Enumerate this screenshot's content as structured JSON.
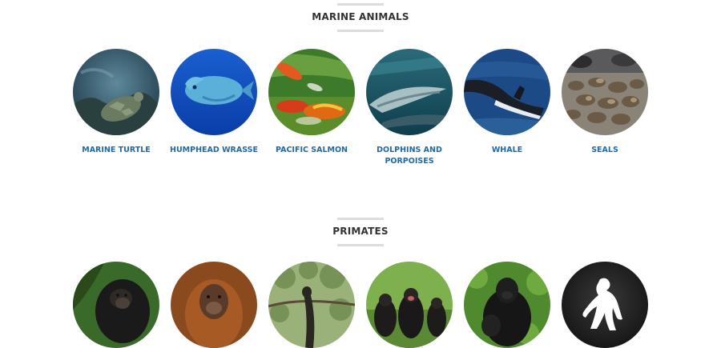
{
  "sections": [
    {
      "title": "MARINE ANIMALS",
      "items": [
        {
          "label": "MARINE TURTLE",
          "icon": "marine-turtle-photo"
        },
        {
          "label": "HUMPHEAD WRASSE",
          "icon": "humphead-wrasse-photo"
        },
        {
          "label": "PACIFIC SALMON",
          "icon": "pacific-salmon-photo"
        },
        {
          "label": "DOLPHINS AND PORPOISES",
          "icon": "dolphins-photo"
        },
        {
          "label": "WHALE",
          "icon": "whale-photo"
        },
        {
          "label": "SEALS",
          "icon": "seals-photo"
        }
      ]
    },
    {
      "title": "PRIMATES",
      "items": [
        {
          "icon": "chimpanzee-photo"
        },
        {
          "icon": "orangutan-photo"
        },
        {
          "icon": "gibbon-photo"
        },
        {
          "icon": "bonobos-photo"
        },
        {
          "icon": "gorilla-photo"
        },
        {
          "icon": "primate-silhouette-icon"
        }
      ]
    }
  ],
  "colors": {
    "label": "#1f6aa5",
    "heading": "#333333",
    "divider": "#dcdcdc"
  }
}
